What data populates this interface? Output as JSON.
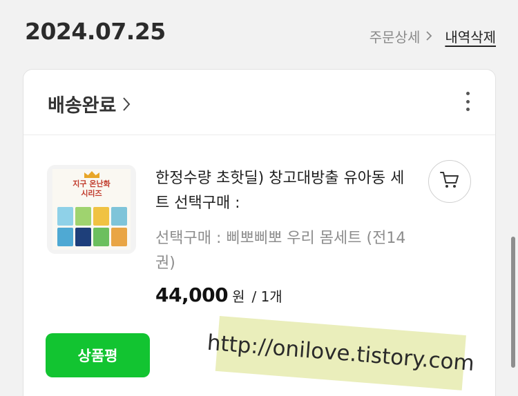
{
  "header": {
    "date": "2024.07.25",
    "order_detail_label": "주문상세",
    "delete_label": "내역삭제"
  },
  "card": {
    "status": "배송완료",
    "product": {
      "thumbnail_title_line1": "지구 온난화",
      "thumbnail_title_line2": "시리즈",
      "name": "한정수량 초핫딜) 창고대방출 유아동 세트 선택구매 :",
      "option": "선택구매 : 삐뽀삐뽀 우리 몸세트 (전14권)",
      "price": "44,000",
      "currency": "원",
      "quantity": "/ 1개"
    },
    "review_button": "상품평"
  },
  "watermark": "http://onilove.tistory.com",
  "colors": {
    "review_green": "#12c431",
    "background": "#f2f2f2",
    "watermark_bg": "#e6ebaf"
  },
  "icons": [
    "chevron-right-icon",
    "more-vertical-icon",
    "cart-icon"
  ]
}
